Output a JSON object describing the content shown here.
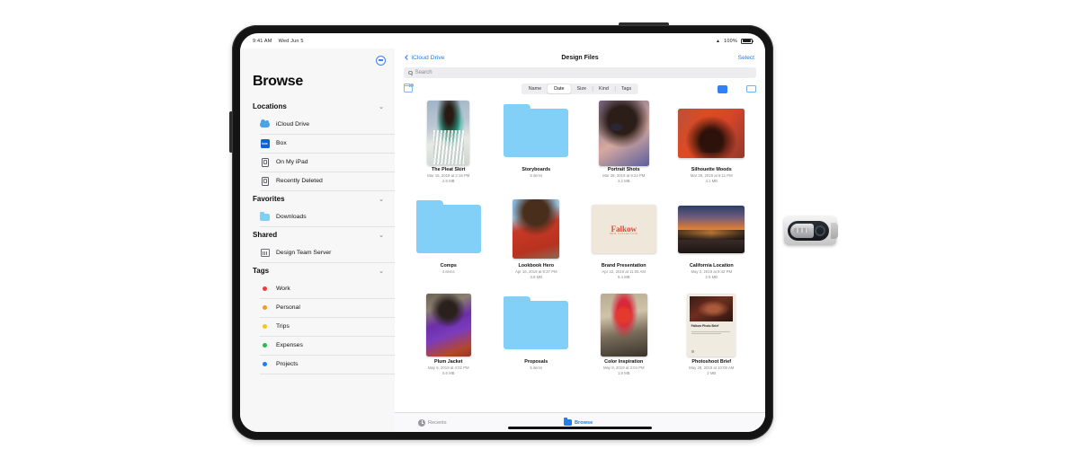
{
  "device": {
    "type": "ipad-pro",
    "status_bar": {
      "time": "9:41 AM",
      "date": "Wed Jun 5",
      "wifi": "wifi-icon",
      "battery_label": "100%"
    }
  },
  "sidebar": {
    "toggle_icon": "hide-sidebar-icon",
    "title": "Browse",
    "sections": [
      {
        "id": "locations",
        "label": "Locations",
        "chevron": "⌄",
        "items": [
          {
            "label": "iCloud Drive",
            "icon": "icloud-drive-icon"
          },
          {
            "label": "Box",
            "icon": "box-app-icon",
            "badge": "box"
          },
          {
            "label": "On My iPad",
            "icon": "ipad-icon"
          },
          {
            "label": "Recently Deleted",
            "icon": "trash-ipad-icon"
          }
        ]
      },
      {
        "id": "favorites",
        "label": "Favorites",
        "chevron": "⌄",
        "items": [
          {
            "label": "Downloads",
            "icon": "downloads-folder-icon"
          }
        ]
      },
      {
        "id": "shared",
        "label": "Shared",
        "chevron": "⌄",
        "items": [
          {
            "label": "Design Team Server",
            "icon": "server-icon"
          }
        ]
      },
      {
        "id": "tags",
        "label": "Tags",
        "chevron": "⌄",
        "items": [
          {
            "label": "Work",
            "icon": "tag-dot-icon",
            "color": "#ef3b36"
          },
          {
            "label": "Personal",
            "icon": "tag-dot-icon",
            "color": "#f59b23"
          },
          {
            "label": "Trips",
            "icon": "tag-dot-icon",
            "color": "#f5c518"
          },
          {
            "label": "Expenses",
            "icon": "tag-dot-icon",
            "color": "#2db84d"
          },
          {
            "label": "Projects",
            "icon": "tag-dot-icon",
            "color": "#1f7cf2"
          }
        ]
      }
    ]
  },
  "navbar": {
    "back_label": "iCloud Drive",
    "back_icon": "chevron-left-icon",
    "title": "Design Files",
    "select_label": "Select"
  },
  "search": {
    "placeholder": "Search",
    "value": "",
    "icon": "search-icon"
  },
  "toolbar": {
    "new_folder_icon": "new-folder-icon",
    "sort_segments": [
      {
        "label": "Name",
        "active": false
      },
      {
        "label": "Date",
        "active": true
      },
      {
        "label": "Size",
        "active": false
      },
      {
        "label": "Kind",
        "active": false
      },
      {
        "label": "Tags",
        "active": false
      }
    ],
    "view_modes": [
      {
        "id": "grid",
        "icon": "grid-view-icon",
        "active": true
      },
      {
        "id": "list",
        "icon": "list-view-icon",
        "active": false
      },
      {
        "id": "column",
        "icon": "column-view-icon",
        "active": false
      }
    ]
  },
  "files": [
    {
      "name": "The Pleat Skirt",
      "kind": "image",
      "thumb": "t1",
      "meta_line_1": "Mar 15, 2019 at 2:18 PM",
      "meta_line_2": "2.6 MB"
    },
    {
      "name": "Storyboards",
      "kind": "folder",
      "thumb": "folder",
      "meta_line_1": "8 items",
      "meta_line_2": ""
    },
    {
      "name": "Portrait Shots",
      "kind": "image",
      "thumb": "t2",
      "meta_line_1": "Mar 28, 2019 at 9:24 PM",
      "meta_line_2": "3.2 MB"
    },
    {
      "name": "Silhouette Moods",
      "kind": "image",
      "thumb": "t3",
      "meta_line_1": "Mar 29, 2019 at 8:11 PM",
      "meta_line_2": "4.1 MB"
    },
    {
      "name": "Comps",
      "kind": "folder",
      "thumb": "folder",
      "meta_line_1": "4 items",
      "meta_line_2": ""
    },
    {
      "name": "Lookbook Hero",
      "kind": "image",
      "thumb": "t4",
      "meta_line_1": "Apr 16, 2019 at 8:37 PM",
      "meta_line_2": "3.8 MB"
    },
    {
      "name": "Brand Presentation",
      "kind": "document",
      "thumb": "t5",
      "brand_word": "Falkow",
      "brand_sub": "NEW COLLECTION",
      "meta_line_1": "Apr 22, 2019 at 11:05 AM",
      "meta_line_2": "9.4 MB"
    },
    {
      "name": "California Location",
      "kind": "image",
      "thumb": "t6",
      "meta_line_1": "May 2, 2019 at 9:42 PM",
      "meta_line_2": "2.9 MB"
    },
    {
      "name": "Plum Jacket",
      "kind": "image",
      "thumb": "t7",
      "meta_line_1": "May 5, 2019 at 4:02 PM",
      "meta_line_2": "5.6 MB"
    },
    {
      "name": "Proposals",
      "kind": "folder",
      "thumb": "folder",
      "meta_line_1": "5 items",
      "meta_line_2": ""
    },
    {
      "name": "Color Inspiration",
      "kind": "image",
      "thumb": "t8",
      "meta_line_1": "May 8, 2019 at 3:04 PM",
      "meta_line_2": "1.8 MB"
    },
    {
      "name": "Photoshoot Brief",
      "kind": "document",
      "thumb": "t9",
      "doc_title": "Falkow\nPhoto Brief",
      "meta_line_1": "May 28, 2019 at 10:09 AM",
      "meta_line_2": "2 MB"
    }
  ],
  "tabbar": {
    "items": [
      {
        "label": "Recents",
        "icon": "recents-clock-icon",
        "active": false
      },
      {
        "label": "Browse",
        "icon": "browse-folder-icon",
        "active": true
      }
    ]
  },
  "accessory": {
    "name": "usb-flash-drive",
    "label": ""
  },
  "colors": {
    "accent_blue": "#1f7cf2",
    "folder_blue": "#82d0f7",
    "sidebar_bg": "#f7f7f7",
    "search_bg": "#ededf0"
  }
}
